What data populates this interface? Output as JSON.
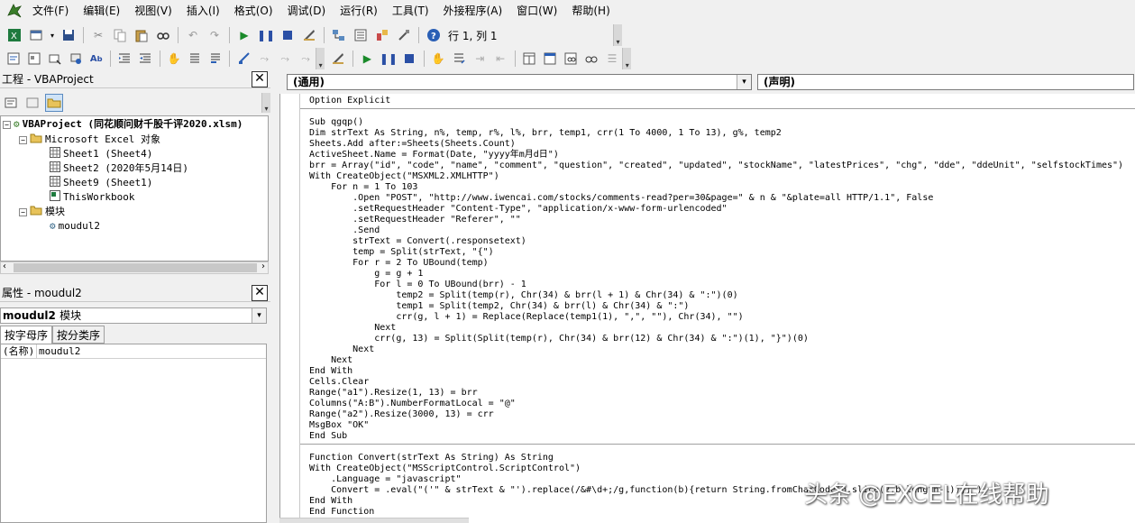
{
  "menu": {
    "items": [
      "文件(F)",
      "编辑(E)",
      "视图(V)",
      "插入(I)",
      "格式(O)",
      "调试(D)",
      "运行(R)",
      "工具(T)",
      "外接程序(A)",
      "窗口(W)",
      "帮助(H)"
    ]
  },
  "toolbar": {
    "position": "行 1, 列 1"
  },
  "project": {
    "title": "工程 - VBAProject",
    "root": "VBAProject (同花顺问财千股千评2020.xlsm)",
    "excel_objects": "Microsoft Excel 对象",
    "sheets": [
      "Sheet1 (Sheet4)",
      "Sheet2 (2020年5月14日)",
      "Sheet9 (Sheet1)",
      "ThisWorkbook"
    ],
    "modules_folder": "模块",
    "module": "moudul2"
  },
  "properties": {
    "title": "属性 - moudul2",
    "object_name": "moudul2",
    "object_type": "模块",
    "tab_alpha": "按字母序",
    "tab_category": "按分类序",
    "row_key": "(名称)",
    "row_value": "moudul2"
  },
  "code_header": {
    "object_combo": "(通用)",
    "proc_combo": "(声明)"
  },
  "code": {
    "section1": "Option Explicit",
    "section2": "Sub qgqp()\nDim strText As String, n%, temp, r%, l%, brr, temp1, crr(1 To 4000, 1 To 13), g%, temp2\nSheets.Add after:=Sheets(Sheets.Count)\nActiveSheet.Name = Format(Date, \"yyyy年m月d日\")\nbrr = Array(\"id\", \"code\", \"name\", \"comment\", \"question\", \"created\", \"updated\", \"stockName\", \"latestPrices\", \"chg\", \"dde\", \"ddeUnit\", \"selfstockTimes\")\nWith CreateObject(\"MSXML2.XMLHTTP\")\n    For n = 1 To 103\n        .Open \"POST\", \"http://www.iwencai.com/stocks/comments-read?per=30&page=\" & n & \"&plate=all HTTP/1.1\", False\n        .setRequestHeader \"Content-Type\", \"application/x-www-form-urlencoded\"\n        .setRequestHeader \"Referer\", \"\"\n        .Send\n        strText = Convert(.responsetext)\n        temp = Split(strText, \"{\")\n        For r = 2 To UBound(temp)\n            g = g + 1\n            For l = 0 To UBound(brr) - 1\n                temp2 = Split(temp(r), Chr(34) & brr(l + 1) & Chr(34) & \":\")(0)\n                temp1 = Split(temp2, Chr(34) & brr(l) & Chr(34) & \":\")\n                crr(g, l + 1) = Replace(Replace(temp1(1), \",\", \"\"), Chr(34), \"\")\n            Next\n            crr(g, 13) = Split(Split(temp(r), Chr(34) & brr(12) & Chr(34) & \":\")(1), \"}\")(0)\n        Next\n    Next\nEnd With\nCells.Clear\nRange(\"a1\").Resize(1, 13) = brr\nColumns(\"A:B\").NumberFormatLocal = \"@\"\nRange(\"a2\").Resize(3000, 13) = crr\nMsgBox \"OK\"\nEnd Sub",
    "section3": "Function Convert(strText As String) As String\nWith CreateObject(\"MSScriptControl.ScriptControl\")\n    .Language = \"javascript\"\n    Convert = .eval(\"('\" & strText & \"').replace(/&#\\d+;/g,function(b){return String.fromCharCode(b.slice(2,b.length-1))})\")\nEnd With\nEnd Function"
  },
  "watermark": "头条 @EXCEL在线帮助"
}
